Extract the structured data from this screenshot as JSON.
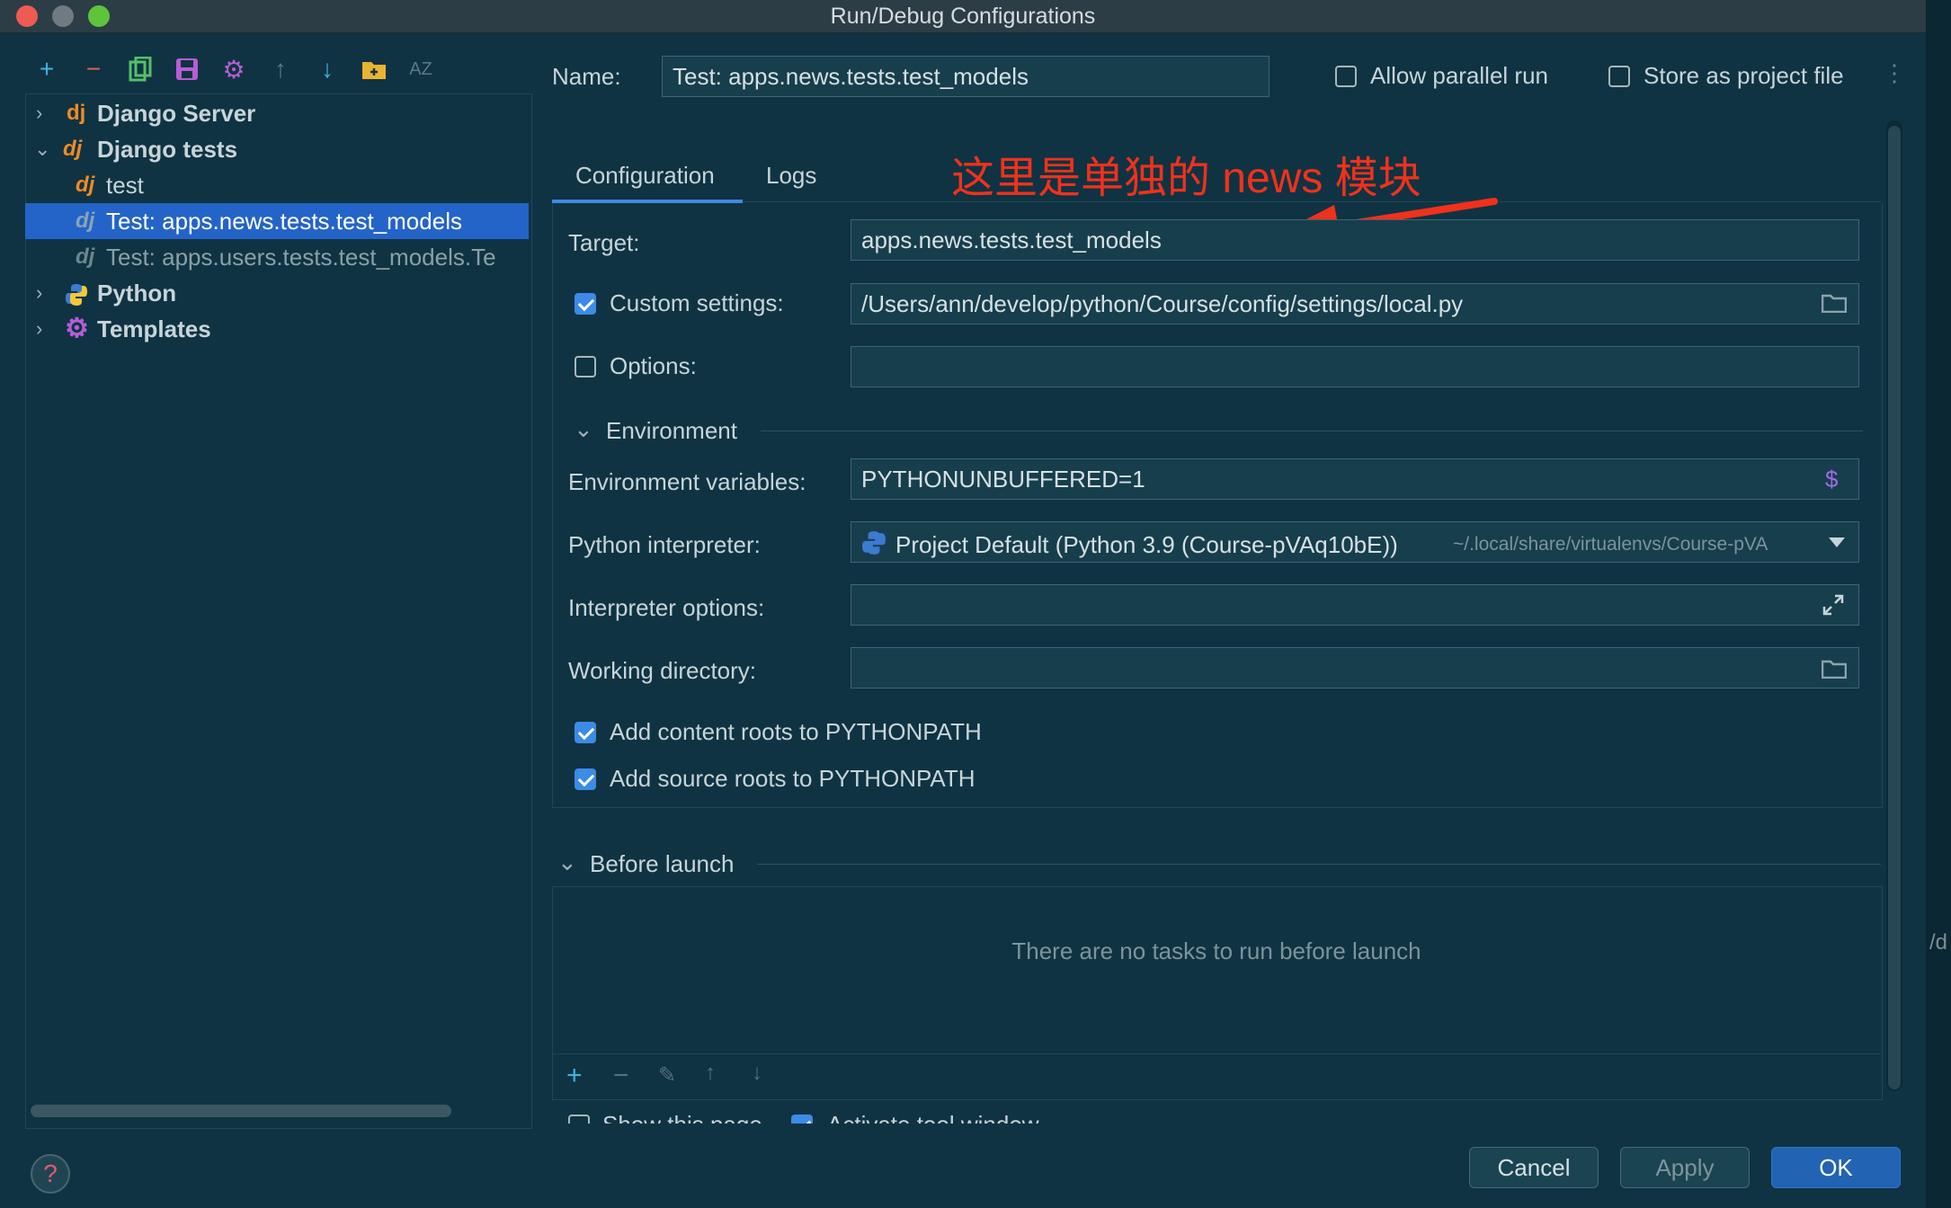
{
  "window": {
    "title": "Run/Debug Configurations"
  },
  "toolbar": {
    "icons": [
      "add-icon",
      "remove-icon",
      "copy-icon",
      "save-icon",
      "settings-icon",
      "move-up-icon",
      "move-down-icon",
      "folder-icon",
      "sort-icon"
    ],
    "sort_glyph": "AZ"
  },
  "tree": {
    "items": [
      {
        "label": "Django Server",
        "icon_text": "dj"
      },
      {
        "label": "Django tests",
        "icon_text": "dj"
      },
      {
        "label": "test",
        "icon_text": "dj"
      },
      {
        "label": "Test: apps.news.tests.test_models",
        "icon_text": "dj"
      },
      {
        "label": "Test: apps.users.tests.test_models.Te",
        "icon_text": "dj"
      },
      {
        "label": "Python"
      },
      {
        "label": "Templates"
      }
    ]
  },
  "header": {
    "name_label": "Name:",
    "name_value": "Test: apps.news.tests.test_models",
    "allow_parallel_label": "Allow parallel run",
    "allow_parallel_checked": false,
    "store_project_label": "Store as project file",
    "store_project_checked": false
  },
  "tabs": [
    {
      "label": "Configuration",
      "active": true
    },
    {
      "label": "Logs",
      "active": false
    }
  ],
  "annotation": {
    "text": "这里是单独的 news 模块",
    "color": "#f0311b"
  },
  "config": {
    "target_label": "Target:",
    "target_value": "apps.news.tests.test_models",
    "custom_settings_label": "Custom settings:",
    "custom_settings_checked": true,
    "custom_settings_value": "/Users/ann/develop/python/Course/config/settings/local.py",
    "options_label": "Options:",
    "options_checked": false,
    "options_value": ""
  },
  "environment": {
    "section_label": "Environment",
    "env_vars_label": "Environment variables:",
    "env_vars_value": "PYTHONUNBUFFERED=1",
    "env_vars_symbol": "$",
    "interpreter_label": "Python interpreter:",
    "interpreter_value": "Project Default (Python 3.9 (Course-pVAq10bE))",
    "interpreter_path": "~/.local/share/virtualenvs/Course-pVA",
    "interpreter_options_label": "Interpreter options:",
    "interpreter_options_value": "",
    "working_dir_label": "Working directory:",
    "working_dir_value": "",
    "add_content_roots_label": "Add content roots to PYTHONPATH",
    "add_content_roots_checked": true,
    "add_source_roots_label": "Add source roots to PYTHONPATH",
    "add_source_roots_checked": true
  },
  "before_launch": {
    "section_label": "Before launch",
    "empty_text": "There are no tasks to run before launch",
    "show_page_label": "Show this page",
    "show_page_checked": false,
    "activate_tool_label": "Activate tool window",
    "activate_tool_checked": true
  },
  "buttons": {
    "cancel": "Cancel",
    "apply": "Apply",
    "ok": "OK"
  },
  "help_glyph": "?",
  "colors": {
    "background": "#0f3342",
    "accent": "#3c8be6",
    "selection": "#2464c8",
    "annotation": "#f0311b"
  }
}
